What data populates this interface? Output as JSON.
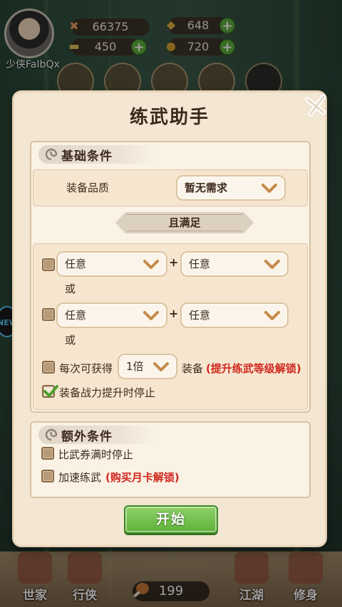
{
  "hud": {
    "player_name": "少侠FaIbQx",
    "power": "66375",
    "gems": "648",
    "silver": "450",
    "coins": "720",
    "food": "199"
  },
  "dialog": {
    "title": "练武助手",
    "basic_section": {
      "title": "基础条件",
      "quality_label": "装备品质",
      "quality_value": "暂无需求"
    },
    "and_banner": "且满足",
    "conditions": {
      "rows": [
        {
          "left": "任意",
          "plus": "+",
          "right": "任意",
          "or": "或"
        },
        {
          "left": "任意",
          "plus": "+",
          "right": "任意",
          "or": "或"
        }
      ],
      "multiplier_prefix": "每次可获得",
      "multiplier_value": "1倍",
      "multiplier_suffix": "装备",
      "multiplier_lock": "(提升练武等级解锁)",
      "stop_on_power": "装备战力提升时停止",
      "stop_on_power_checked": true
    },
    "extra_section": {
      "title": "额外条件",
      "stop_on_voucher": "比武券满时停止",
      "speed_label": "加速练武",
      "speed_lock": "(购买月卡解锁)"
    },
    "start_button": "开始"
  },
  "bottom_nav": [
    {
      "label": "世家"
    },
    {
      "label": "行侠"
    },
    {
      "label": "江湖"
    },
    {
      "label": "修身"
    }
  ],
  "colors": {
    "dialog_bg": "#f3e6d3",
    "start_button": "#5eb13a",
    "lock_text": "#d0281e"
  }
}
